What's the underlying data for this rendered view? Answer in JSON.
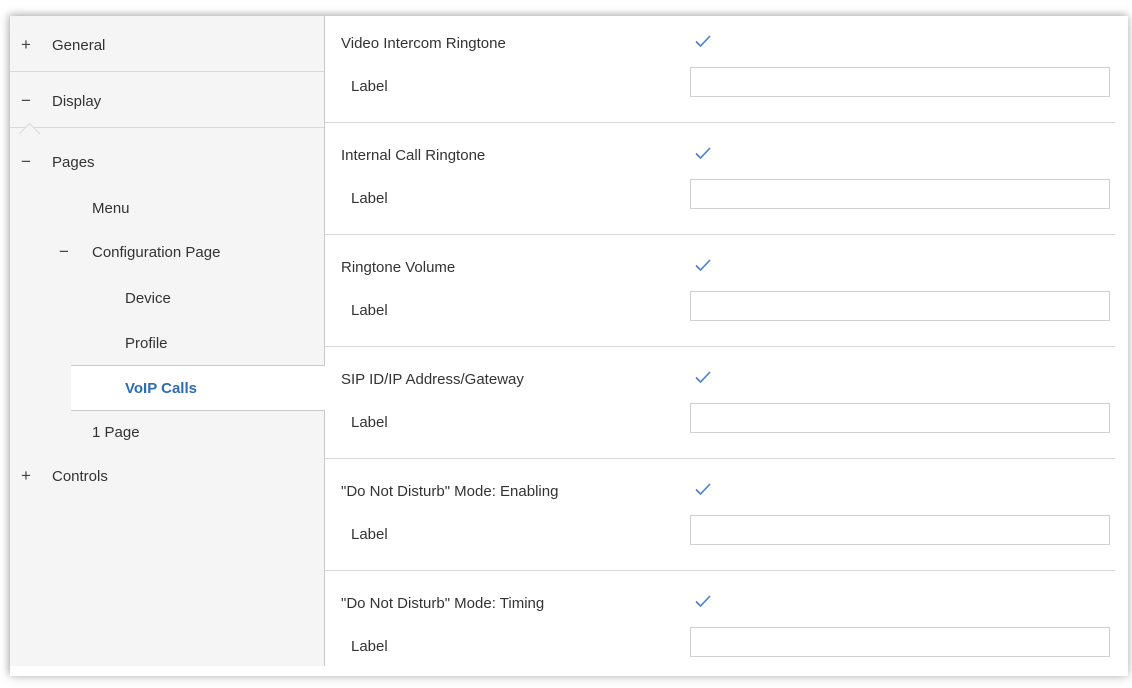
{
  "sidebar": {
    "items": [
      {
        "label": "General",
        "expander": "+"
      },
      {
        "label": "Display",
        "expander": "−"
      },
      {
        "label": "Pages",
        "expander": "−"
      },
      {
        "label": "Menu"
      },
      {
        "label": "Configuration Page",
        "expander": "−"
      },
      {
        "label": "Device"
      },
      {
        "label": "Profile"
      },
      {
        "label": "VoIP Calls",
        "selected": true
      },
      {
        "label": "1 Page"
      },
      {
        "label": "Controls",
        "expander": "+"
      }
    ]
  },
  "content": {
    "sections": [
      {
        "title": "Video Intercom Ringtone",
        "checked": true,
        "field_label": "Label",
        "field_value": ""
      },
      {
        "title": "Internal Call Ringtone",
        "checked": true,
        "field_label": "Label",
        "field_value": ""
      },
      {
        "title": "Ringtone Volume",
        "checked": true,
        "field_label": "Label",
        "field_value": ""
      },
      {
        "title": "SIP ID/IP Address/Gateway",
        "checked": true,
        "field_label": "Label",
        "field_value": ""
      },
      {
        "title": "\"Do Not Disturb\" Mode: Enabling",
        "checked": true,
        "field_label": "Label",
        "field_value": ""
      },
      {
        "title": "\"Do Not Disturb\" Mode: Timing",
        "checked": true,
        "field_label": "Label",
        "field_value": ""
      }
    ]
  },
  "colors": {
    "selected_text": "#2e6db4",
    "checkmark": "#4a7fc4",
    "sidebar_bg": "#f5f5f5"
  },
  "icons": {
    "checkbox": "check-icon",
    "expand": "plus-icon",
    "collapse": "minus-icon"
  }
}
